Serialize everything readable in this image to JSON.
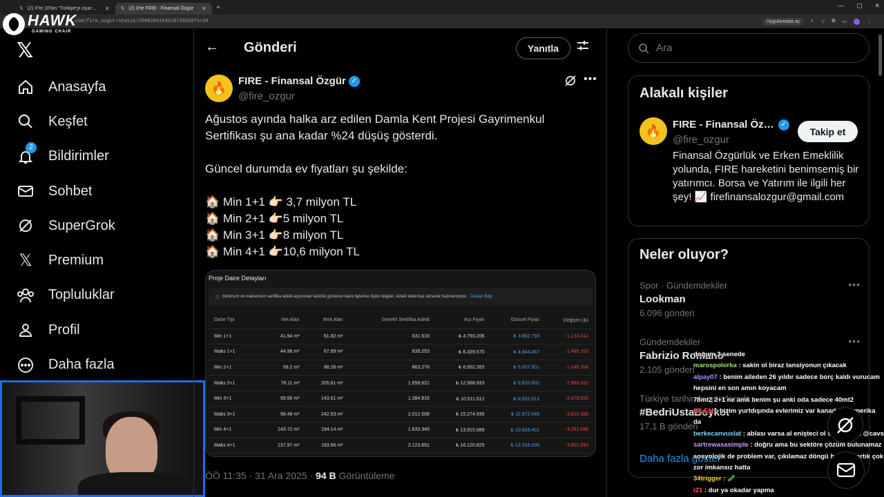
{
  "browser": {
    "tabs": [
      {
        "label": "(2) X'te 10'lan \"Türkiye'yi ziyar…",
        "active": false
      },
      {
        "label": "(2) X'te FIRE - Finansal Özgür",
        "active": true
      }
    ],
    "url": "x.com/fire_ozgur/status/2006283164520739320?s=20",
    "app_chip": "Uygulamada aç"
  },
  "overlay_logo": {
    "name": "HAWK",
    "sub": "GAMING CHAIR"
  },
  "sidebar": {
    "items": [
      {
        "label": "Anasayfa",
        "icon": "home-icon"
      },
      {
        "label": "Keşfet",
        "icon": "search-icon"
      },
      {
        "label": "Bildirimler",
        "icon": "bell-icon",
        "badge": "2"
      },
      {
        "label": "Sohbet",
        "icon": "mail-icon"
      },
      {
        "label": "SuperGrok",
        "icon": "grok-icon"
      },
      {
        "label": "Premium",
        "icon": "x-icon"
      },
      {
        "label": "Topluluklar",
        "icon": "people-icon"
      },
      {
        "label": "Profil",
        "icon": "person-icon"
      },
      {
        "label": "Daha fazla",
        "icon": "more-circle-icon"
      }
    ]
  },
  "post": {
    "header_title": "Gönderi",
    "reply_label": "Yanıtla",
    "author_name": "FIRE - Finansal Özgür",
    "author_handle": "@fire_ozgur",
    "text_p1_l1": "Ağustos ayında halka arz edilen Damla Kent Projesi Gayrimenkul",
    "text_p1_l2": "Sertifikası şu ana kadar %24 düşüş gösterdi.",
    "text_p2": "Güncel durumda ev fiyatları şu şekilde:",
    "price_lines": [
      "🏠 Min 1+1 👉🏻 3,7 milyon TL",
      "🏠 Min 2+1 👉🏻5 milyon TL",
      "🏠 Min 3+1 👉🏻8 milyon TL",
      "🏠 Min 4+1 👉🏻10,6 milyon TL"
    ],
    "timestamp": "ÖÖ 11:35 · 31 Ara 2025 · ",
    "views": "94 B",
    "views_label": " Görüntüleme"
  },
  "card": {
    "title": "Proje Daire Detayları",
    "note": "Minimum ve maksimum sertifika adedi açısından farklılık gösteren daire tiplerine ilişkin bilgiler, ekteki tablo baz alınarak hazırlanmıştır.",
    "note_link": "Detaylı Bilgi",
    "headers": [
      "Daire Tipi",
      "Net Alan",
      "Brüt Alan",
      "Gerekli Sertifika Adedi",
      "Arz Fiyatı",
      "Güncel Fiyatı",
      "Değişim (₺)"
    ],
    "rows": [
      [
        "Min 1+1",
        "41.94 m²",
        "61.82 m²",
        "631.516",
        "₺ 4.793.206",
        "₺ 3.662.793",
        "-1.130.414"
      ],
      [
        "Maks 1+1",
        "44.98 m²",
        "67.89 m²",
        "835.253",
        "₺ 6.339.570",
        "₺ 4.844.467",
        "-1.495.103"
      ],
      [
        "Min 2+1",
        "58.2 m²",
        "88.26 m²",
        "863.276",
        "₺ 6.552.265",
        "₺ 5.007.001",
        "-1.545.264"
      ],
      [
        "Maks 2+1",
        "78.11 m²",
        "205.81 m²",
        "1.658.621",
        "₺ 12.588.933",
        "₺ 9.620.002",
        "-2.968.932"
      ],
      [
        "Min 3+1",
        "99.56 m²",
        "143.61 m²",
        "1.384.916",
        "₺ 10.511.512",
        "₺ 8.032.513",
        "-2.479.000"
      ],
      [
        "Maks 3+1",
        "98.49 m²",
        "242.93 m²",
        "2.012.508",
        "₺ 15.274.936",
        "₺ 11.672.546",
        "-3.602.389"
      ],
      [
        "Min 4+1",
        "143.72 m²",
        "194.14 m²",
        "1.833.345",
        "₺ 13.915.089",
        "₺ 10.633.401",
        "-3.281.688"
      ],
      [
        "Maks 4+1",
        "137.97 m²",
        "193.96 m²",
        "2.123.851",
        "₺ 16.120.829",
        "₺ 12.318.336",
        "-3.801.693"
      ]
    ]
  },
  "right": {
    "search_placeholder": "Ara",
    "related_title": "Alakalı kişiler",
    "related_name": "FIRE - Finansal Öz…",
    "related_handle": "@fire_ozgur",
    "follow_label": "Takip et",
    "related_bio": "Finansal Özgürlük ve Erken Emeklilik yolunda, FIRE hareketini benimsemiş bir yatırımcı. Borsa ve Yatırım ile ilgili her şey! 📈 firefinansalozgur@gmail.com",
    "trends_title": "Neler oluyor?",
    "trends": [
      {
        "category": "Spor · Gündemdekiler",
        "name": "Lookman",
        "count": "6.096 gönderi"
      },
      {
        "category": "Gündemdekiler",
        "name": "Fabrizio Romano",
        "count": "2.105 gönderi"
      },
      {
        "category": "Türkiye tarihinde gündemde",
        "name": "#BedriUstaBoykot",
        "count": "17,1 B gönderi"
      }
    ],
    "show_more": "Daha fazla göster"
  },
  "chat": [
    {
      "user": "",
      "text": "doğum 3 senede",
      "color": "#ffffff"
    },
    {
      "user": "marospolorka",
      "text": " : sakin ol biraz tansiyonun çıkacak",
      "color": "#9be36b"
    },
    {
      "user": "alpay07",
      "text": " : benim aileden 26 yıldır sadece borç kaldı vurucam hepsini en son amın koyacam",
      "color": "#b48aff"
    },
    {
      "user": "",
      "text": "78mt2 2+1 ne amk benim şu anki oda sadece 40mt2",
      "color": "#ffffff"
    },
    {
      "user": "HILEM",
      "text": " : bizim yurtdışında evlerimiz var kanada ve amerika da",
      "color": "#ff5a5a"
    },
    {
      "user": "berkecanvuslat",
      "text": " : ablası varsa al enişteci ol salak olma @cavs",
      "color": "#7cd5ff"
    },
    {
      "user": "sartrewasasimple",
      "text": " : doğru ama bu sektöre çözüm bulunamaz sosyolojik de problem var, çıkılamaz döngü ha sıçış artık çok zor imkansız hatta",
      "color": "#c69cff"
    },
    {
      "user": "34trigger",
      "text": " : 🥒",
      "color": "#ffd24a"
    },
    {
      "user": "i21",
      "text": " : dur ya okadar yapma",
      "color": "#ff5a5a"
    }
  ]
}
